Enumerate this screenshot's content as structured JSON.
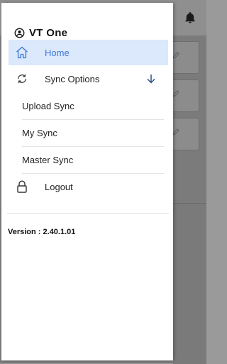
{
  "app": {
    "title": "VT One",
    "version_text": "Version : 2.40.1.01"
  },
  "drawer": {
    "home_label": "Home",
    "sync_options_label": "Sync Options",
    "sync_sub_items": [
      "Upload Sync",
      "My Sync",
      "Master Sync"
    ],
    "logout_label": "Logout"
  },
  "icons": {
    "brand": "account-circle-icon",
    "home": "home-icon",
    "sync": "sync-icon",
    "expand": "arrow-down-icon",
    "logout": "lock-icon",
    "notifications": "bell-icon"
  },
  "colors": {
    "accent": "#3b78d8",
    "active_bg": "#dce8fb"
  }
}
